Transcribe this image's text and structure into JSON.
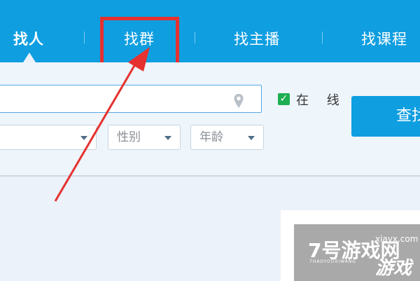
{
  "tabs": [
    {
      "label": "找人",
      "active": true
    },
    {
      "label": "找群",
      "active": false
    },
    {
      "label": "找主播",
      "active": false
    },
    {
      "label": "找课程",
      "active": false
    }
  ],
  "search": {
    "value": ""
  },
  "filters": {
    "first": "",
    "gender": "性别",
    "age": "年龄"
  },
  "online": {
    "label": "在 线",
    "checked": true
  },
  "find_button": {
    "label": "查找"
  },
  "watermark": {
    "big": "7号游戏网",
    "url": "xiayx.com",
    "pinyin": "7HAOYOUXIWANG",
    "game": "游戏"
  },
  "colors": {
    "brand": "#0f9ee0",
    "annotation": "#e5312f",
    "checkbox": "#1fae52"
  }
}
